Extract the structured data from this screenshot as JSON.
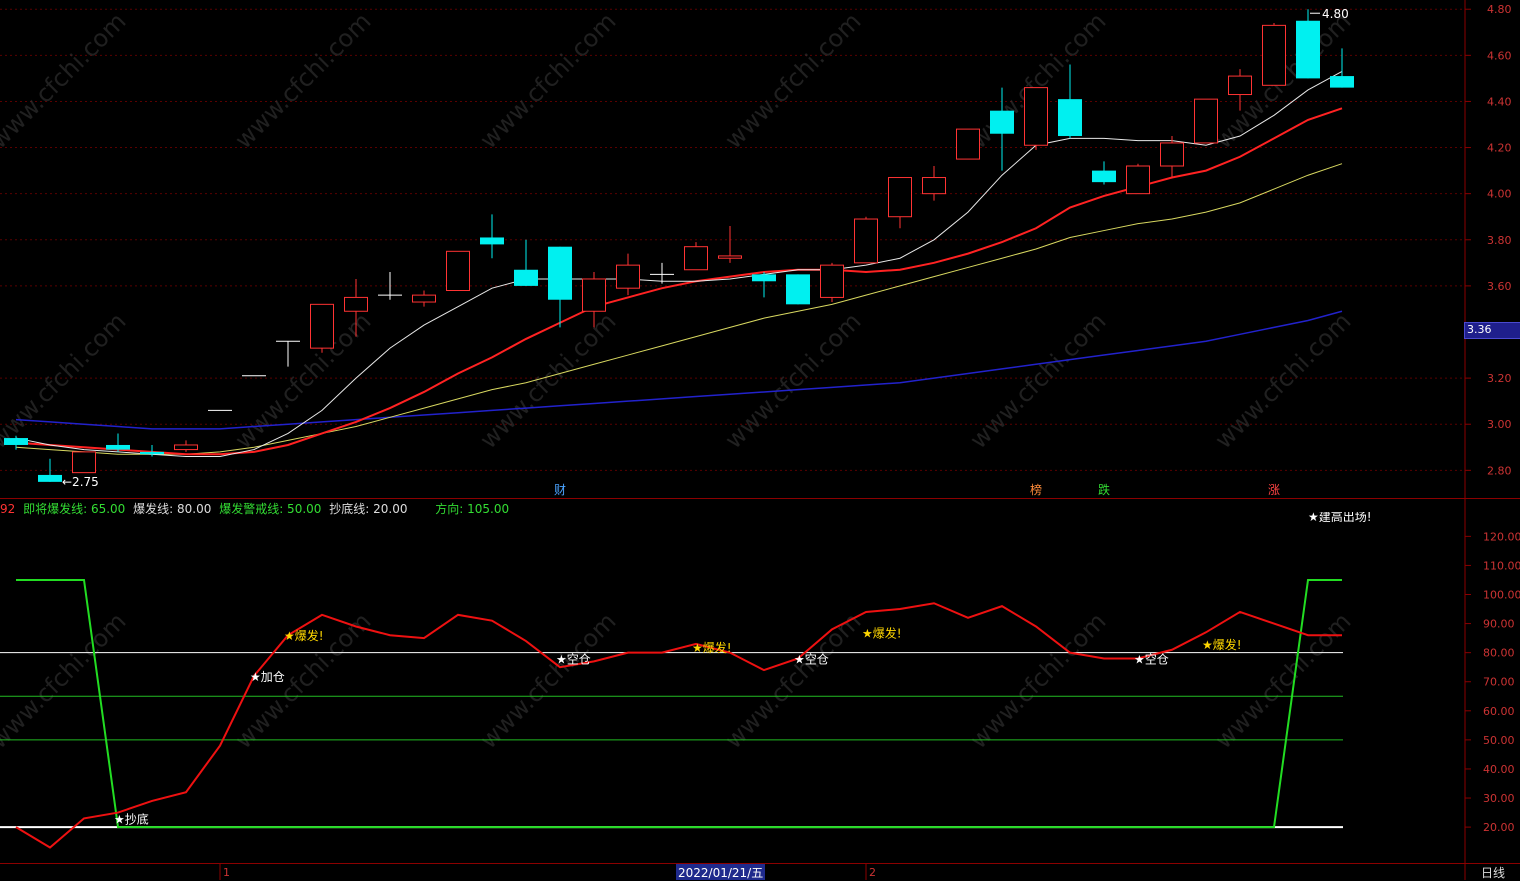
{
  "price_panel": {
    "y_ticks": [
      "4.80",
      "4.60",
      "4.40",
      "4.20",
      "4.00",
      "3.80",
      "3.60",
      "3.20",
      "3.00",
      "2.80"
    ],
    "current_price": "3.36",
    "high_label": "4.80",
    "low_label": "2.75",
    "markers": [
      {
        "text": "财",
        "color": "#4aa3ff",
        "i": 16
      },
      {
        "text": "榜",
        "color": "#ff8c3a",
        "i": 30
      },
      {
        "text": "跌",
        "color": "#33dd33",
        "i": 32
      },
      {
        "text": "涨",
        "color": "#ff4444",
        "i": 37
      }
    ]
  },
  "indicator_panel": {
    "legend": [
      {
        "text": "92",
        "color": "#ff3333"
      },
      {
        "text": "即将爆发线: 65.00",
        "color": "#33dd33"
      },
      {
        "text": "爆发线: 80.00",
        "color": "#dddddd"
      },
      {
        "text": "爆发警戒线: 50.00",
        "color": "#33dd33"
      },
      {
        "text": "抄底线: 20.00",
        "color": "#dddddd"
      },
      {
        "text": "方向: 105.00",
        "color": "#33dd33"
      }
    ],
    "y_ticks": [
      "120.00",
      "110.00",
      "100.00",
      "90.00",
      "80.00",
      "70.00",
      "60.00",
      "50.00",
      "40.00",
      "30.00",
      "20.00"
    ],
    "signals": [
      {
        "text": "★抄底",
        "color": "#ffffff",
        "i": 3,
        "v": 23
      },
      {
        "text": "★加仓",
        "color": "#ffffff",
        "i": 7,
        "v": 72
      },
      {
        "text": "★爆发!",
        "color": "#ffd700",
        "i": 8,
        "v": 86
      },
      {
        "text": "★空仓",
        "color": "#ffffff",
        "i": 16,
        "v": 78
      },
      {
        "text": "★爆发!",
        "color": "#ffd700",
        "i": 20,
        "v": 82
      },
      {
        "text": "★空仓",
        "color": "#ffffff",
        "i": 23,
        "v": 78
      },
      {
        "text": "★爆发!",
        "color": "#ffd700",
        "i": 25,
        "v": 87
      },
      {
        "text": "★空仓",
        "color": "#ffffff",
        "i": 33,
        "v": 78
      },
      {
        "text": "★爆发!",
        "color": "#ffd700",
        "i": 35,
        "v": 83
      }
    ],
    "partial_signal": "★建高出场!"
  },
  "x_axis": {
    "date_label": "2022/01/21/五",
    "marks": [
      "1",
      "2"
    ]
  },
  "timeframe": "日线",
  "watermark": "www.cfchi.com",
  "chart_data": {
    "type": "candlestick",
    "candles": [
      [
        2.94,
        2.91,
        2.95,
        2.89
      ],
      [
        2.78,
        2.75,
        2.85,
        2.75
      ],
      [
        2.79,
        2.88,
        2.88,
        2.79
      ],
      [
        2.91,
        2.89,
        2.96,
        2.88
      ],
      [
        2.88,
        2.87,
        2.91,
        2.86
      ],
      [
        2.89,
        2.91,
        2.93,
        2.88
      ],
      [
        3.06,
        3.06,
        3.06,
        3.06
      ],
      [
        3.21,
        3.21,
        3.21,
        3.21
      ],
      [
        3.36,
        3.36,
        3.36,
        3.25
      ],
      [
        3.33,
        3.52,
        3.52,
        3.31
      ],
      [
        3.49,
        3.55,
        3.63,
        3.38
      ],
      [
        3.56,
        3.56,
        3.66,
        3.54
      ],
      [
        3.53,
        3.56,
        3.58,
        3.51
      ],
      [
        3.58,
        3.75,
        3.75,
        3.58
      ],
      [
        3.81,
        3.78,
        3.91,
        3.72
      ],
      [
        3.67,
        3.6,
        3.8,
        3.6
      ],
      [
        3.77,
        3.54,
        3.77,
        3.42
      ],
      [
        3.49,
        3.63,
        3.66,
        3.42
      ],
      [
        3.59,
        3.69,
        3.74,
        3.56
      ],
      [
        3.65,
        3.65,
        3.7,
        3.61
      ],
      [
        3.67,
        3.77,
        3.79,
        3.67
      ],
      [
        3.72,
        3.73,
        3.86,
        3.7
      ],
      [
        3.65,
        3.62,
        3.66,
        3.55
      ],
      [
        3.65,
        3.52,
        3.65,
        3.52
      ],
      [
        3.55,
        3.69,
        3.7,
        3.53
      ],
      [
        3.7,
        3.89,
        3.9,
        3.7
      ],
      [
        3.9,
        4.07,
        4.07,
        3.85
      ],
      [
        4.0,
        4.07,
        4.12,
        3.97
      ],
      [
        4.15,
        4.28,
        4.28,
        4.15
      ],
      [
        4.36,
        4.26,
        4.46,
        4.1
      ],
      [
        4.21,
        4.46,
        4.46,
        4.19
      ],
      [
        4.41,
        4.25,
        4.56,
        4.24
      ],
      [
        4.1,
        4.05,
        4.14,
        4.04
      ],
      [
        4.0,
        4.12,
        4.13,
        4.0
      ],
      [
        4.12,
        4.22,
        4.25,
        4.07
      ],
      [
        4.22,
        4.41,
        4.41,
        4.22
      ],
      [
        4.43,
        4.51,
        4.54,
        4.36
      ],
      [
        4.47,
        4.73,
        4.74,
        4.47
      ],
      [
        4.75,
        4.5,
        4.8,
        4.5
      ],
      [
        4.51,
        4.46,
        4.63,
        4.46
      ]
    ],
    "ma5": [
      2.94,
      2.91,
      2.89,
      2.88,
      2.87,
      2.86,
      2.86,
      2.89,
      2.96,
      3.06,
      3.2,
      3.33,
      3.43,
      3.51,
      3.59,
      3.63,
      3.63,
      3.63,
      3.63,
      3.62,
      3.62,
      3.63,
      3.65,
      3.67,
      3.67,
      3.69,
      3.72,
      3.8,
      3.92,
      4.08,
      4.21,
      4.24,
      4.24,
      4.23,
      4.23,
      4.21,
      4.25,
      4.34,
      4.45,
      4.53
    ],
    "ma10": [
      2.92,
      2.91,
      2.9,
      2.89,
      2.88,
      2.87,
      2.87,
      2.88,
      2.91,
      2.96,
      3.01,
      3.07,
      3.14,
      3.22,
      3.29,
      3.37,
      3.44,
      3.51,
      3.55,
      3.59,
      3.62,
      3.64,
      3.66,
      3.67,
      3.67,
      3.66,
      3.67,
      3.7,
      3.74,
      3.79,
      3.85,
      3.94,
      3.99,
      4.03,
      4.07,
      4.1,
      4.16,
      4.24,
      4.32,
      4.37
    ],
    "ma20": [
      2.9,
      2.89,
      2.88,
      2.87,
      2.87,
      2.87,
      2.88,
      2.9,
      2.93,
      2.96,
      2.99,
      3.03,
      3.07,
      3.11,
      3.15,
      3.18,
      3.22,
      3.26,
      3.3,
      3.34,
      3.38,
      3.42,
      3.46,
      3.49,
      3.52,
      3.56,
      3.6,
      3.64,
      3.68,
      3.72,
      3.76,
      3.81,
      3.84,
      3.87,
      3.89,
      3.92,
      3.96,
      4.02,
      4.08,
      4.13
    ],
    "ma60": [
      3.02,
      3.01,
      3.0,
      2.99,
      2.98,
      2.98,
      2.98,
      2.99,
      3.0,
      3.01,
      3.02,
      3.03,
      3.04,
      3.05,
      3.06,
      3.07,
      3.08,
      3.09,
      3.1,
      3.11,
      3.12,
      3.13,
      3.14,
      3.15,
      3.16,
      3.17,
      3.18,
      3.2,
      3.22,
      3.24,
      3.26,
      3.28,
      3.3,
      3.32,
      3.34,
      3.36,
      3.39,
      3.42,
      3.45,
      3.49
    ],
    "indicator": [
      20,
      13,
      23,
      25,
      29,
      32,
      48,
      72,
      86,
      93,
      89,
      86,
      85,
      93,
      91,
      84,
      75,
      77,
      80,
      80,
      83,
      80,
      74,
      78,
      88,
      94,
      95,
      97,
      92,
      96,
      89,
      80,
      78,
      78,
      81,
      87,
      94,
      90,
      86,
      86
    ],
    "direction": [
      105,
      105,
      105,
      20,
      20,
      20,
      20,
      20,
      20,
      20,
      20,
      20,
      20,
      20,
      20,
      20,
      20,
      20,
      20,
      20,
      20,
      20,
      20,
      20,
      20,
      20,
      20,
      20,
      20,
      20,
      20,
      20,
      20,
      20,
      20,
      20,
      20,
      20,
      105,
      105
    ],
    "levels": {
      "burst": 80,
      "pre_burst": 65,
      "alert": 50,
      "bottom": 20
    },
    "price_ylim": [
      2.68,
      4.84
    ],
    "indicator_ylim": [
      8,
      127
    ]
  }
}
